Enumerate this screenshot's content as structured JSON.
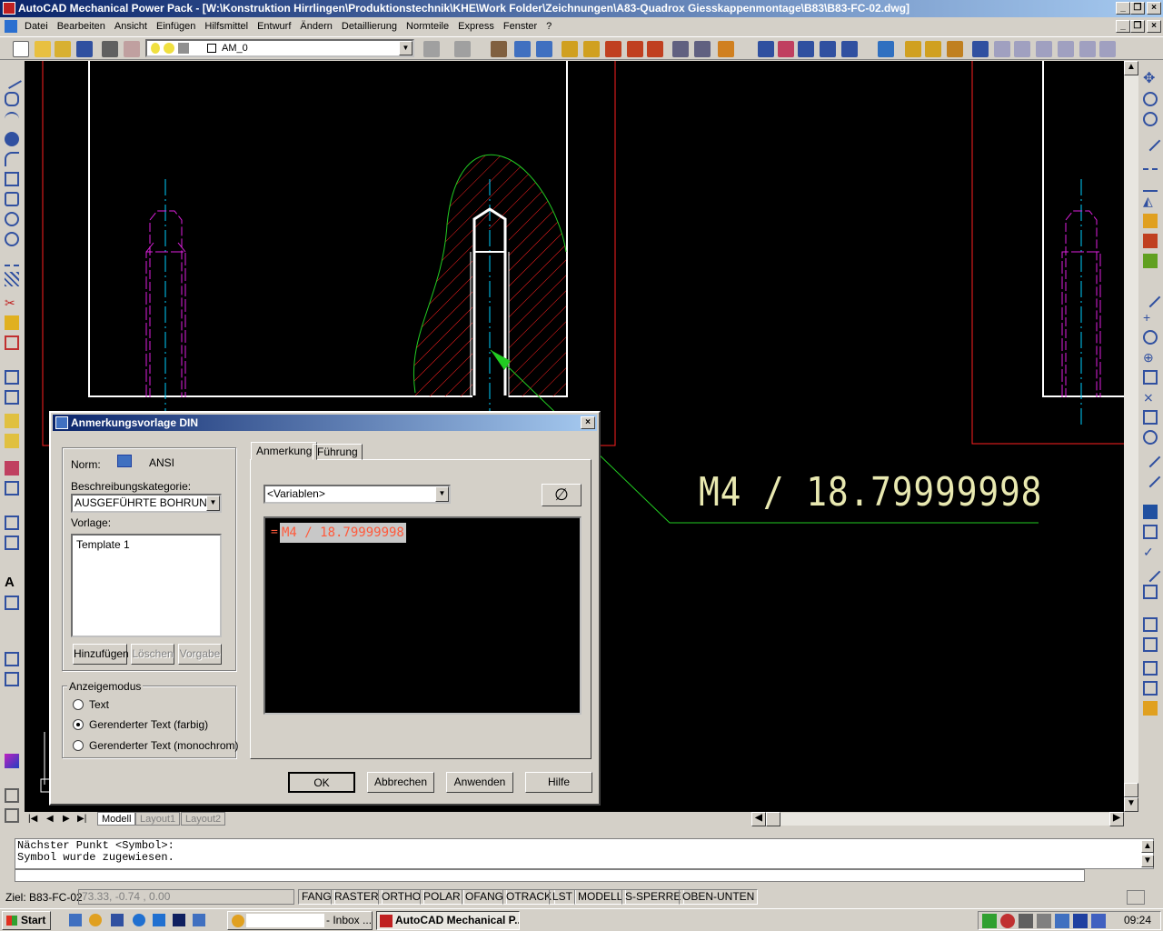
{
  "window": {
    "title": "AutoCAD Mechanical Power Pack - [W:\\Konstruktion Hirrlingen\\Produktionstechnik\\KHE\\Work Folder\\Zeichnungen\\A83-Quadrox Giesskappenmontage\\B83\\B83-FC-02.dwg]"
  },
  "menu": [
    "Datei",
    "Bearbeiten",
    "Ansicht",
    "Einfügen",
    "Hilfsmittel",
    "Entwurf",
    "Ändern",
    "Detaillierung",
    "Normteile",
    "Express",
    "Fenster",
    "?"
  ],
  "toolbar": {
    "layer_name": "AM_0"
  },
  "drawing": {
    "annotation_text": "M4 / 18.79999998"
  },
  "layout_tabs": [
    "Modell",
    "Layout1",
    "Layout2"
  ],
  "command_line": {
    "line1": "Nächster Punkt <Symbol>:",
    "line2": "Symbol wurde zugewiesen."
  },
  "status": {
    "target_label": "Ziel: B83-FC-02",
    "coordinates": "73.33, -0.74 , 0.00",
    "toggles": [
      "FANG",
      "RASTER",
      "ORTHO",
      "POLAR",
      "OFANG",
      "OTRACK",
      "LST",
      "MODELL",
      "S-SPERRE",
      "OBEN-UNTEN"
    ]
  },
  "dialog": {
    "title": "Anmerkungsvorlage DIN",
    "norm_label": "Norm:",
    "norm_value": "ANSI",
    "category_label": "Beschreibungskategorie:",
    "category_value": "AUSGEFÜHRTE BOHRUNG",
    "template_label": "Vorlage:",
    "template_items": [
      "Template 1"
    ],
    "add_button": "Hinzufügen",
    "delete_button": "Löschen",
    "default_button": "Vorgabe",
    "display_mode_label": "Anzeigemodus",
    "display_modes": [
      "Text",
      "Gerenderter Text (farbig)",
      "Gerenderter Text (monochrom)"
    ],
    "selected_mode": "Gerenderter Text (farbig)",
    "tabs": [
      "Anmerkung",
      "Führung"
    ],
    "variables_value": "<Variablen>",
    "diameter_symbol": "∅",
    "editor_prefix": "=",
    "editor_text": "M4 / 18.79999998",
    "ok_button": "OK",
    "cancel_button": "Abbrechen",
    "apply_button": "Anwenden",
    "help_button": "Hilfe"
  },
  "taskbar": {
    "start": "Start",
    "inbox": "- Inbox ...",
    "autocad": "AutoCAD Mechanical P...",
    "clock": "09:24"
  },
  "colors": {
    "title_gradient_start": "#0a246a",
    "canvas": "#000000",
    "annotation": "#e8e8b0",
    "hatch": "#ff2020",
    "leader": "#22cc22",
    "centerline": "#00d0ff",
    "thread": "#e020e0",
    "editor_text": "#ff5a3c"
  }
}
